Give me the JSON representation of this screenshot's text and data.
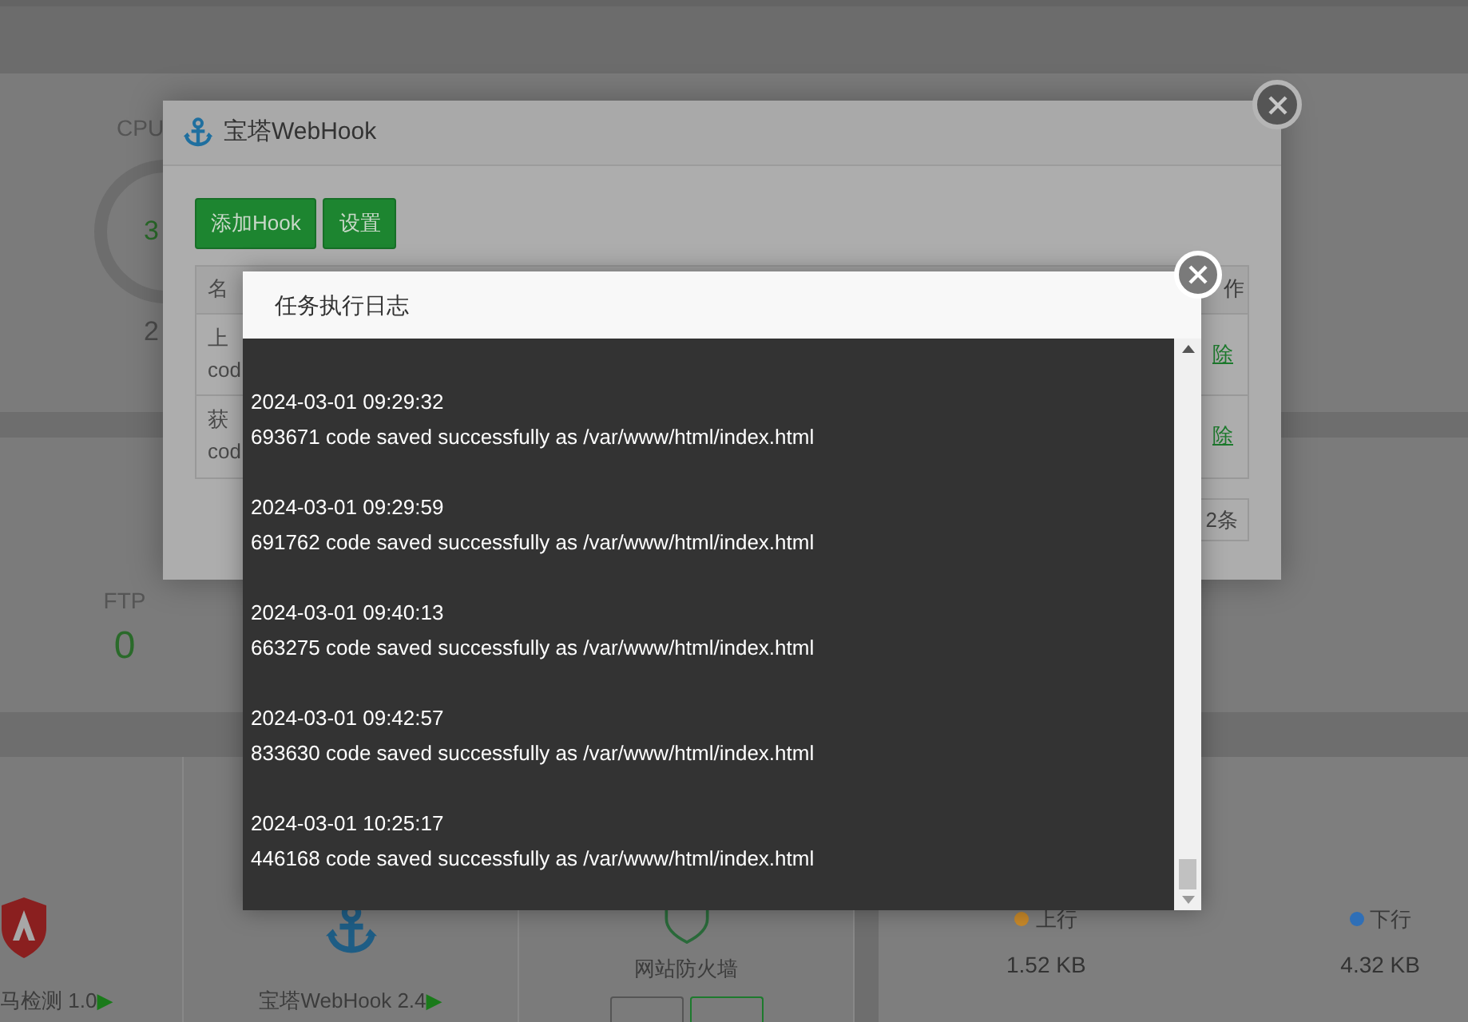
{
  "dashboard": {
    "cpu": {
      "label": "CPU",
      "value": "3",
      "cores": "2"
    },
    "ftp": {
      "label": "FTP",
      "value": "0"
    },
    "software": [
      {
        "kind": "shield",
        "name": "马检测 1.0",
        "arrow": "▶"
      },
      {
        "kind": "anchor",
        "name": "宝塔WebHook 2.4",
        "arrow": "▶"
      },
      {
        "kind": "waf",
        "name": "网站防火墙"
      }
    ],
    "network": [
      {
        "label": "上行",
        "value": "1.52 KB",
        "color": "#c8892a"
      },
      {
        "label": "下行",
        "value": "4.32 KB",
        "color": "#2f6fb7"
      }
    ]
  },
  "webhook_dialog": {
    "title": "宝塔WebHook",
    "buttons": [
      "添加Hook",
      "设置"
    ],
    "table": {
      "columns": [
        "名",
        "作"
      ],
      "rows": [
        {
          "name": [
            "上",
            "cod"
          ],
          "action": "除"
        },
        {
          "name": [
            "获",
            "cod"
          ],
          "action": "除"
        }
      ]
    },
    "pagination": "2条"
  },
  "log_dialog": {
    "title": "任务执行日志",
    "entries": [
      {
        "time": "2024-03-01 09:29:32",
        "message": "693671 code saved successfully as /var/www/html/index.html"
      },
      {
        "time": "2024-03-01 09:29:59",
        "message": "691762 code saved successfully as /var/www/html/index.html"
      },
      {
        "time": "2024-03-01 09:40:13",
        "message": "663275 code saved successfully as /var/www/html/index.html"
      },
      {
        "time": "2024-03-01 09:42:57",
        "message": "833630 code saved successfully as /var/www/html/index.html"
      },
      {
        "time": "2024-03-01 10:25:17",
        "message": "446168 code saved successfully as /var/www/html/index.html"
      }
    ]
  }
}
